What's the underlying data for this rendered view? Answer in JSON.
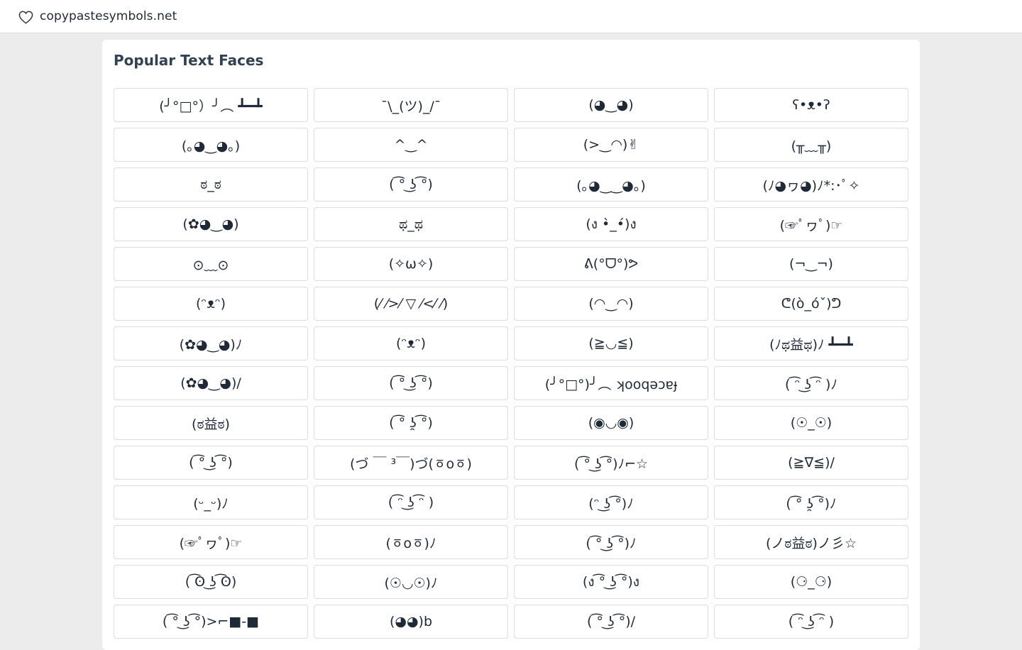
{
  "header": {
    "site_name": "copypastesymbols.net",
    "logo_icon": "heart-outline-icon"
  },
  "section": {
    "title": "Popular Text Faces"
  },
  "faces": [
    "(╯°□°）╯︵ ┻━┻",
    "¯\\_(ツ)_/¯",
    "(◕‿◕)",
    "ʕ•ᴥ•ʔ",
    "(｡◕‿◕｡)",
    "^‿^",
    "(>‿◠)✌",
    "(╥﹏╥)",
    "ಠ_ಠ",
    "( ͡° ͜ʖ ͡°)",
    "(｡◕‿‿◕｡)",
    "(ﾉ◕ヮ◕)ﾉ*:･ﾟ✧",
    "(✿◕‿◕)",
    "ಥ_ಥ",
    "(ง •̀_•́)ง",
    "(☞ﾟヮﾟ)☞",
    "⊙﹏⊙",
    "(✧ω✧)",
    "ᕕ(°ᗜ°)ᕗ",
    "(¬‿¬)",
    "(ᵔᴥᵔ)",
    "(⁄ ⁄>⁄ ▽ ⁄<⁄ ⁄)",
    "(◠‿◠)",
    "ᕦ(ò_óˇ)ᕤ",
    "(✿◕‿◕)ﾉ",
    "(ᵔᴥᵔ)",
    "(≧◡≦)",
    "(ﾉಥ益ಥ)ﾉ﻿ ┻━┻",
    "(✿◕‿◕)/",
    "( ͡° ͜ʖ ͡°)",
    "(╯°□°)╯︵ ʞooqǝɔɐɟ",
    "( ͡ᵔ ͜ʖ ͡ᵔ )ﾉ",
    "(ಠ益ಠ)",
    "( ͡° ʖ̯ ͡°)",
    "(◉◡◉)",
    "(☉_☉)",
    "( ͡° ͜ʖ ͡°)",
    "(づ ￣ ³￣)づ(ㆆoㆆ)",
    "( ͡° ͜ʖ ͡°)ﾉ⌐☆",
    "(≧∇≦)/",
    "(ᵕ_ᵕ)ﾉ",
    "( ͡ᵔ ͜ʖ ͡ᵔ )",
    "(ᵔ ͜ʖ ͡°)ﾉ",
    "( ͡° ʖ̯ ͡°)ﾉ",
    "(☞ﾟヮﾟ)☞",
    "(ㆆoㆆ)ﾉ",
    "( ͡° ͜ʖ ͡°)ﾉ",
    "(ノಠ益ಠ)ノ彡☆",
    "( ͡ʘ ͜ʖ ͡ʘ)",
    "(☉◡☉)ﾉ",
    "(ง ͡° ͜ʖ ͡°)ง",
    "(⚆_⚆)",
    "( ͡° ͜ʖ ͡°)>⌐■-■",
    "(◕◕)b",
    "( ͡° ͜ʖ ͡°)/",
    "( ͡ᵔ ͜ʖ ͡ᵔ )"
  ]
}
